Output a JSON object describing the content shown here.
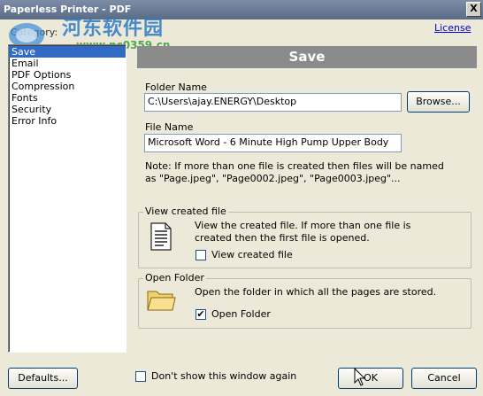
{
  "window": {
    "title": "Paperless Printer - PDF",
    "close_label": "X"
  },
  "watermark": {
    "line1": "河东软件园",
    "line2": "www.pc0359.cn"
  },
  "category_label": "Category:",
  "license_link": "License",
  "categories": [
    "Save",
    "Email",
    "PDF Options",
    "Compression",
    "Fonts",
    "Security",
    "Error Info"
  ],
  "selected_category": "Save",
  "panel": {
    "title": "Save",
    "folder_name_label": "Folder Name",
    "folder_name_value": "C:\\Users\\ajay.ENERGY\\Desktop",
    "browse_label": "Browse...",
    "file_name_label": "File Name",
    "file_name_value": "Microsoft Word - 6 Minute High Pump Upper Body",
    "note_line1": "Note: If more than one file is created then files will be named",
    "note_line2": "as \"Page.jpeg\", \"Page0002.jpeg\", \"Page0003.jpeg\"...",
    "view_group": {
      "title": "View created file",
      "desc_line1": "View the created file. If more than one file is",
      "desc_line2": "created then the first file is opened.",
      "checkbox_label": "View created file",
      "checked": false
    },
    "open_group": {
      "title": "Open Folder",
      "desc": "Open the folder in which all the pages are stored.",
      "checkbox_label": "Open Folder",
      "checked": true
    }
  },
  "footer": {
    "defaults_label": "Defaults...",
    "dont_show_label": "Don't show this window again",
    "dont_show_checked": false,
    "ok_label": "OK",
    "cancel_label": "Cancel"
  },
  "icons": {
    "close": "close-icon",
    "document": "document-icon",
    "folder": "folder-icon",
    "cursor": "mouse-cursor-icon",
    "check": "checkmark-icon"
  }
}
